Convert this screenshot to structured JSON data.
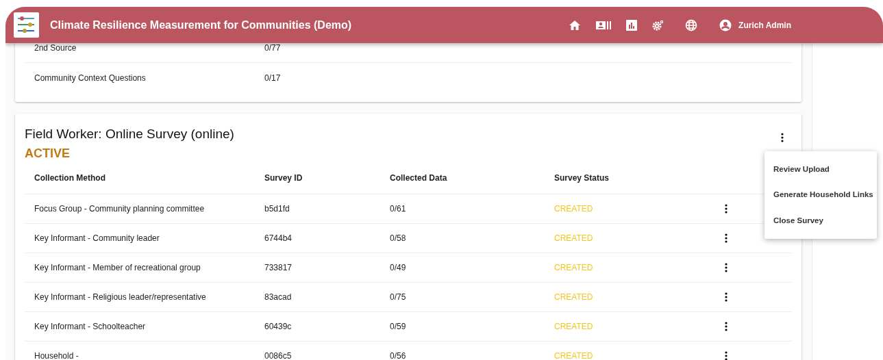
{
  "app_bar": {
    "title": "Climate Resilience Measurement for Communities (Demo)",
    "user": "Zurich Admin"
  },
  "previous_card": {
    "rows": [
      {
        "name": "2nd Source",
        "collected": "0/77"
      },
      {
        "name": "Community Context Questions",
        "collected": "0/17"
      }
    ]
  },
  "survey_card": {
    "title": "Field Worker: Online Survey (online)",
    "state": "ACTIVE",
    "columns": [
      "Collection Method",
      "Survey ID",
      "Collected Data",
      "Survey Status"
    ],
    "rows": [
      {
        "method": "Focus Group - Community planning committee",
        "survey_id": "b5d1fd",
        "collected": "0/61",
        "status": "CREATED"
      },
      {
        "method": "Key Informant - Community leader",
        "survey_id": "6744b4",
        "collected": "0/58",
        "status": "CREATED"
      },
      {
        "method": "Key Informant - Member of recreational group",
        "survey_id": "733817",
        "collected": "0/49",
        "status": "CREATED"
      },
      {
        "method": "Key Informant - Religious leader/representative",
        "survey_id": "83acad",
        "collected": "0/75",
        "status": "CREATED"
      },
      {
        "method": "Key Informant - Schoolteacher",
        "survey_id": "60439c",
        "collected": "0/59",
        "status": "CREATED"
      },
      {
        "method": "Household -",
        "survey_id": "0086c5",
        "collected": "0/56",
        "status": "CREATED"
      }
    ],
    "menu": [
      "Review Upload",
      "Generate Household Links",
      "Close Survey"
    ]
  }
}
